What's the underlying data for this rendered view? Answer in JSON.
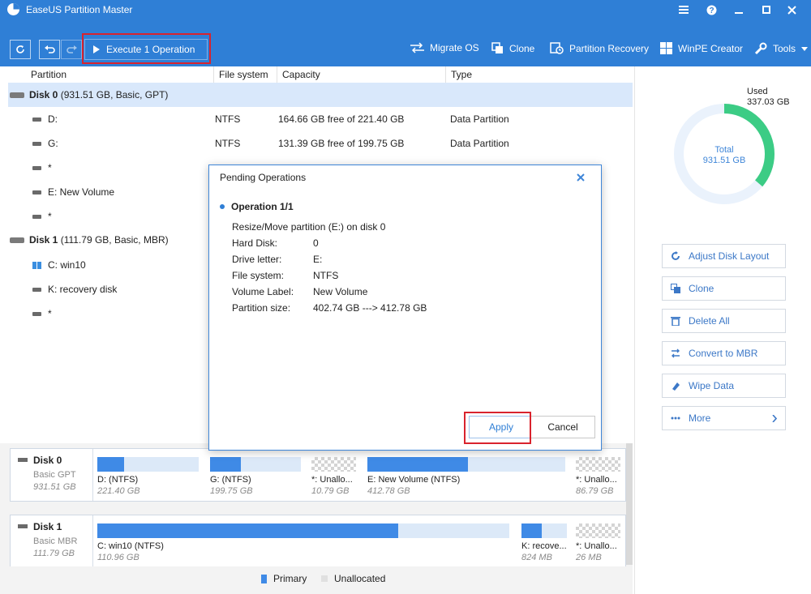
{
  "app": {
    "title": "EaseUS Partition Master"
  },
  "titlebar": {
    "window_controls": [
      "menu-icon",
      "help-icon",
      "minimize-icon",
      "maximize-icon",
      "close-icon"
    ]
  },
  "toolbar": {
    "execute_label": "Execute 1 Operation",
    "tools": [
      {
        "label": "Migrate OS",
        "icon": "migrate-os-icon"
      },
      {
        "label": "Clone",
        "icon": "clone-icon"
      },
      {
        "label": "Partition Recovery",
        "icon": "partition-recovery-icon"
      },
      {
        "label": "WinPE Creator",
        "icon": "winpe-icon"
      },
      {
        "label": "Tools",
        "icon": "tools-icon"
      }
    ]
  },
  "table": {
    "columns": [
      "Partition",
      "File system",
      "Capacity",
      "Type"
    ],
    "rows": [
      {
        "kind": "disk",
        "name": "Disk 0",
        "detail": " (931.51 GB, Basic, GPT)",
        "fs": "",
        "capacity": "",
        "type": ""
      },
      {
        "kind": "part",
        "name": "D:",
        "fs": "NTFS",
        "capacity": "164.66 GB free of 221.40 GB",
        "type": "Data Partition"
      },
      {
        "kind": "part",
        "name": "G:",
        "fs": "NTFS",
        "capacity": "131.39 GB free of 199.75 GB",
        "type": "Data Partition"
      },
      {
        "kind": "part",
        "name": "*",
        "fs": "",
        "capacity": "",
        "type": ""
      },
      {
        "kind": "part",
        "name": "E: New Volume",
        "fs": "",
        "capacity": "",
        "type": ""
      },
      {
        "kind": "part",
        "name": "*",
        "fs": "",
        "capacity": "",
        "type": ""
      },
      {
        "kind": "disk",
        "name": "Disk 1",
        "detail": " (111.79 GB, Basic, MBR)",
        "fs": "",
        "capacity": "",
        "type": ""
      },
      {
        "kind": "win",
        "name": "C: win10",
        "fs": "",
        "capacity": "",
        "type": ""
      },
      {
        "kind": "part",
        "name": "K: recovery disk",
        "fs": "",
        "capacity": "",
        "type": ""
      },
      {
        "kind": "part",
        "name": "*",
        "fs": "",
        "capacity": "",
        "type": ""
      }
    ]
  },
  "donut": {
    "used_label": "Used",
    "used_value": "337.03 GB",
    "total_label": "Total",
    "total_value": "931.51 GB",
    "used_fraction": 0.362
  },
  "actions": [
    {
      "label": "Adjust Disk Layout",
      "icon": "adjust-layout-icon"
    },
    {
      "label": "Clone",
      "icon": "clone-icon"
    },
    {
      "label": "Delete All",
      "icon": "trash-icon"
    },
    {
      "label": "Convert to MBR",
      "icon": "convert-icon"
    },
    {
      "label": "Wipe Data",
      "icon": "wipe-icon"
    },
    {
      "label": "More",
      "icon": "more-icon"
    }
  ],
  "disks": [
    {
      "name": "Disk 0",
      "style": "Basic GPT",
      "size": "931.51 GB",
      "partitions": [
        {
          "name": "D:  (NTFS)",
          "size": "221.40 GB",
          "used_fraction": 0.26,
          "unalloc": false
        },
        {
          "name": "G:  (NTFS)",
          "size": "199.75 GB",
          "used_fraction": 0.34,
          "unalloc": false
        },
        {
          "name": "*: Unallo...",
          "size": "10.79 GB",
          "used_fraction": 0,
          "unalloc": true
        },
        {
          "name": "E: New Volume (NTFS)",
          "size": "412.78 GB",
          "used_fraction": 0.51,
          "unalloc": false
        },
        {
          "name": "*: Unallo...",
          "size": "86.79 GB",
          "used_fraction": 0,
          "unalloc": true
        }
      ]
    },
    {
      "name": "Disk 1",
      "style": "Basic MBR",
      "size": "111.79 GB",
      "partitions": [
        {
          "name": "C: win10 (NTFS)",
          "size": "110.96 GB",
          "used_fraction": 0.73,
          "unalloc": false
        },
        {
          "name": "K: recove...",
          "size": "824 MB",
          "used_fraction": 0.45,
          "unalloc": false
        },
        {
          "name": "*: Unallo...",
          "size": "26 MB",
          "used_fraction": 0,
          "unalloc": true
        }
      ]
    }
  ],
  "legend": {
    "primary": "Primary",
    "unallocated": "Unallocated"
  },
  "dialog": {
    "title": "Pending Operations",
    "op_heading": "Operation 1/1",
    "op_desc": "Resize/Move partition (E:) on disk 0",
    "fields": [
      {
        "label": "Hard Disk:",
        "value": "0"
      },
      {
        "label": "Drive letter:",
        "value": "E:"
      },
      {
        "label": "File system:",
        "value": "NTFS"
      },
      {
        "label": "Volume Label:",
        "value": "New Volume"
      },
      {
        "label": "Partition size:",
        "value": "402.74 GB ---> 412.78 GB"
      }
    ],
    "apply_label": "Apply",
    "cancel_label": "Cancel"
  },
  "colors": {
    "accent": "#2f7fd6",
    "highlight_outline": "#d9232d",
    "donut_used": "#3ccc85",
    "donut_track": "#eaf2fc"
  }
}
